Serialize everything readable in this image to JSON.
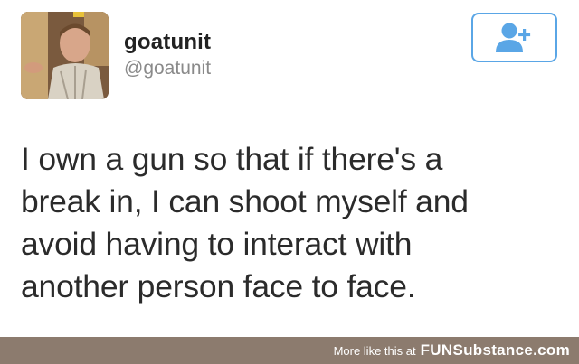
{
  "tweet": {
    "display_name": "goatunit",
    "handle": "@goatunit",
    "lines": [
      "I own a gun so that if there's a",
      "break in, I can shoot myself and",
      "avoid having to interact with",
      "another person face to face."
    ],
    "follow_icon": "add-user-icon",
    "accent_color": "#5aa6e6"
  },
  "footer": {
    "text": "More like this at",
    "brand": "FUNSubstance.com",
    "background": "#8c7b6e"
  }
}
